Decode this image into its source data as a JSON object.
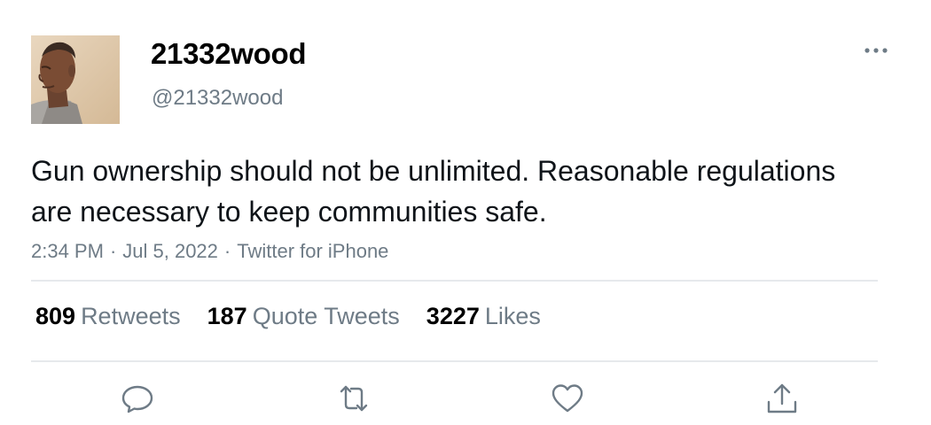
{
  "user": {
    "display_name": "21332wood",
    "handle": "@21332wood",
    "avatar_icon": "profile-photo"
  },
  "tweet": {
    "text": "Gun ownership should not be unlimited. Reasonable regulations are necessary to keep communities safe.",
    "time": "2:34 PM",
    "date": "Jul 5, 2022",
    "source": "Twitter for iPhone",
    "separator": "·"
  },
  "stats": {
    "retweets_count": "809",
    "retweets_label": "Retweets",
    "quote_tweets_count": "187",
    "quote_tweets_label": "Quote Tweets",
    "likes_count": "3227",
    "likes_label": "Likes"
  },
  "actions": {
    "icons": [
      "reply-icon",
      "retweet-icon",
      "like-icon",
      "share-icon"
    ]
  },
  "colors": {
    "text": "#0f1419",
    "muted": "#6e7b86",
    "divider": "#e6e9ec"
  }
}
